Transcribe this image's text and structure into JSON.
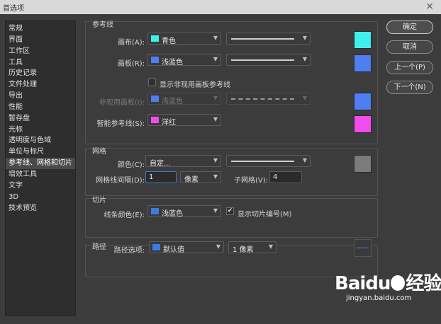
{
  "window": {
    "title": "首选项",
    "close_icon": "×"
  },
  "sidebar": {
    "items": [
      "常规",
      "界面",
      "工作区",
      "工具",
      "历史记录",
      "文件处理",
      "导出",
      "性能",
      "暂存盘",
      "光标",
      "透明度与色域",
      "单位与标尺",
      "参考线、网格和切片",
      "增效工具",
      "文字",
      "3D",
      "技术预览"
    ],
    "active_index": 12
  },
  "guides": {
    "title": "参考线",
    "canvas_label": "画布(A):",
    "canvas_color": "青色",
    "canvas_hex": "#3ff0ee",
    "artboard_label": "画板(R):",
    "artboard_color": "浅蓝色",
    "artboard_hex": "#4f7df4",
    "show_inactive_label": "显示非现用画板参考线",
    "inactive_label": "非现用画板(I):",
    "inactive_color": "浅蓝色",
    "inactive_hex": "#4f7df4",
    "smart_label": "智能参考线(S):",
    "smart_color": "洋红",
    "smart_hex": "#f04cf0"
  },
  "grid": {
    "title": "网格",
    "color_label": "颜色(C):",
    "color_value": "自定...",
    "color_hex": "#7b7b7b",
    "gridline_label": "网格线间隔(D):",
    "gridline_value": "1",
    "unit_value": "像素",
    "subdiv_label": "子网格(V):",
    "subdiv_value": "4"
  },
  "slices": {
    "title": "切片",
    "line_label": "线条颜色(E):",
    "line_color": "浅蓝色",
    "line_hex": "#3b7be6",
    "show_numbers_label": "显示切片编号(M)",
    "show_numbers_checked": "✔"
  },
  "path": {
    "title": "路径",
    "options_label": "路径选项:",
    "options_value": "默认值",
    "options_hex": "#3b7be6",
    "width_value": "1 像素"
  },
  "buttons": {
    "ok": "确定",
    "cancel": "取消",
    "prev": "上一个(P)",
    "next": "下一个(N)"
  },
  "watermark": {
    "brand": "Baidu",
    "brand_suffix": "经验",
    "url": "jingyan.baidu.com"
  }
}
